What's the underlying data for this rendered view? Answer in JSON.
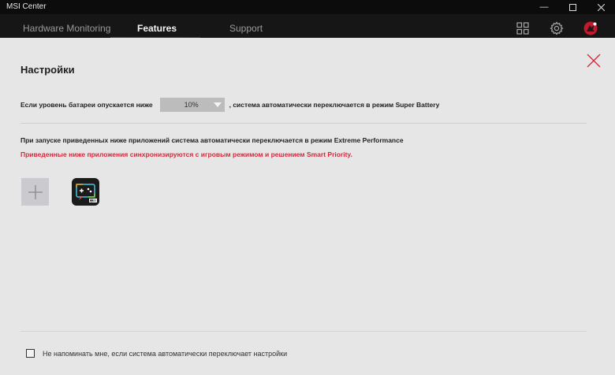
{
  "window": {
    "title": "MSI Center"
  },
  "tabs": [
    {
      "label": "Hardware Monitoring",
      "active": false
    },
    {
      "label": "Features",
      "active": true
    },
    {
      "label": "Support",
      "active": false
    }
  ],
  "toolbar_icons": [
    "grid-apps-icon",
    "settings-gear-icon",
    "dragon-avatar-icon"
  ],
  "window_controls": [
    "minimize-icon",
    "maximize-icon",
    "close-icon"
  ],
  "settings": {
    "heading": "Настройки",
    "battery_prefix": "Если уровень батареи опускается ниже",
    "battery_value": "10%",
    "battery_suffix": ", система автоматически переключается в режим Super Battery",
    "apps_info": "При запуске приведенных ниже приложений система автоматически переключается в режим Extreme Performance",
    "apps_warning": "Приведенные ниже приложения синхронизируются с игровым режимом и решением Smart Priority.",
    "apps": [
      {
        "name": "msi-gaming-app-icon"
      }
    ],
    "dont_remind_label": "Не напоминать мне, если система автоматически переключает настройки",
    "dont_remind_checked": false
  },
  "colors": {
    "warning": "#d6283c",
    "close_x": "#d6283c",
    "tab_underline": "#5a3f8a"
  }
}
